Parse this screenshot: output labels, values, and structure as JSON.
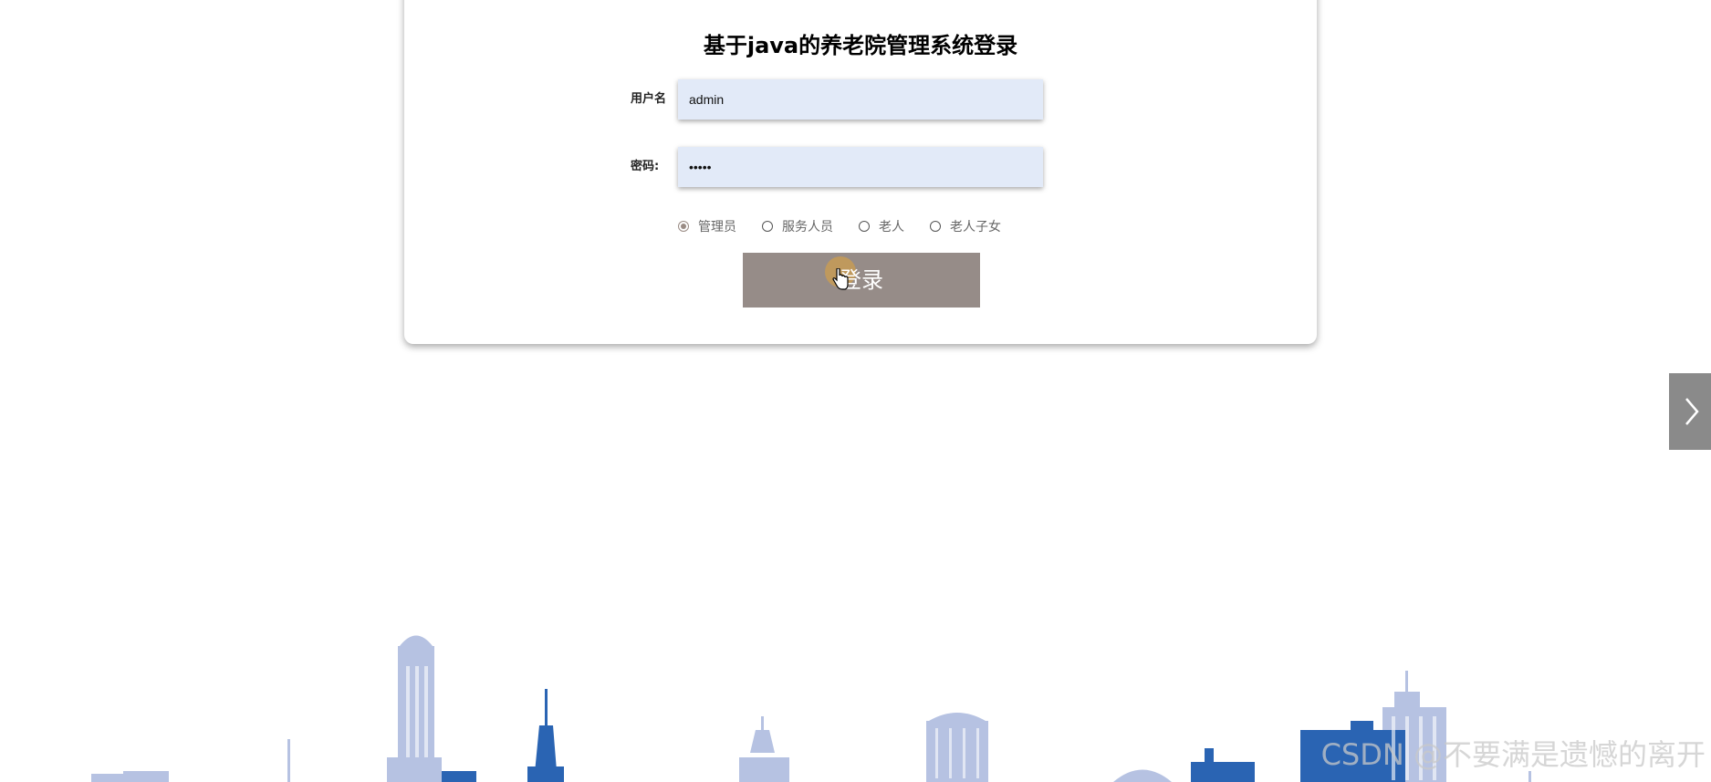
{
  "login": {
    "title": "基于java的养老院管理系统登录",
    "username_label": "用户名",
    "username_value": "admin",
    "password_label": "密码:",
    "password_value": "•••••",
    "roles": [
      {
        "label": "管理员",
        "checked": true
      },
      {
        "label": "服务人员",
        "checked": false
      },
      {
        "label": "老人",
        "checked": false
      },
      {
        "label": "老人子女",
        "checked": false
      }
    ],
    "button_label": "登录"
  },
  "colors": {
    "button_bg": "#968c88",
    "input_bg": "#e2eaf8",
    "skyline_light": "#b6c2e2",
    "skyline_dark": "#2a64b3"
  },
  "icons": {
    "next": "chevron-right-icon",
    "cursor": "hand-pointer-icon"
  },
  "watermark": "CSDN @不要满是遗憾的离开"
}
